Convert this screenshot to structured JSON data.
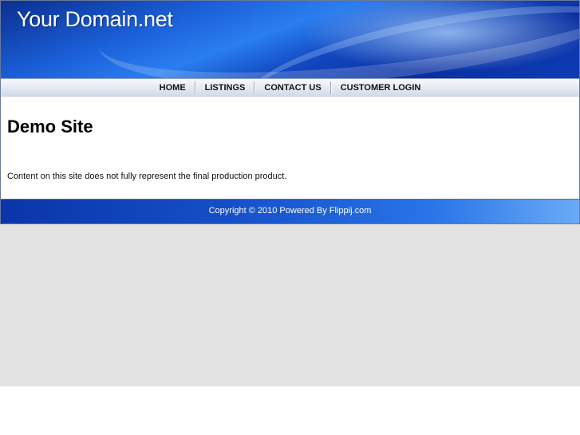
{
  "site": {
    "title": "Your Domain.net"
  },
  "nav": {
    "items": [
      {
        "label": "HOME"
      },
      {
        "label": "LISTINGS"
      },
      {
        "label": "CONTACT US"
      },
      {
        "label": "CUSTOMER LOGIN"
      }
    ]
  },
  "main": {
    "heading": "Demo Site",
    "body": "Content on this site does not fully represent the final production product."
  },
  "footer": {
    "text": "Copyright © 2010 Powered By Flippij.com"
  },
  "colors": {
    "header_blue": "#1b5fd8",
    "footer_blue": "#1550c8",
    "page_background": "#e3e3e3"
  }
}
